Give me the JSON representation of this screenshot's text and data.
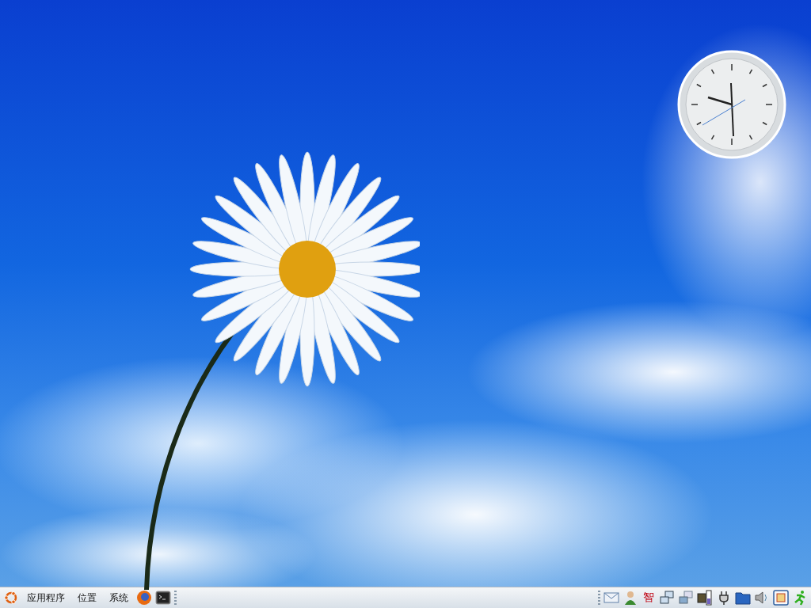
{
  "panel": {
    "menus": [
      "应用程序",
      "位置",
      "系统"
    ],
    "input_method": "智"
  }
}
